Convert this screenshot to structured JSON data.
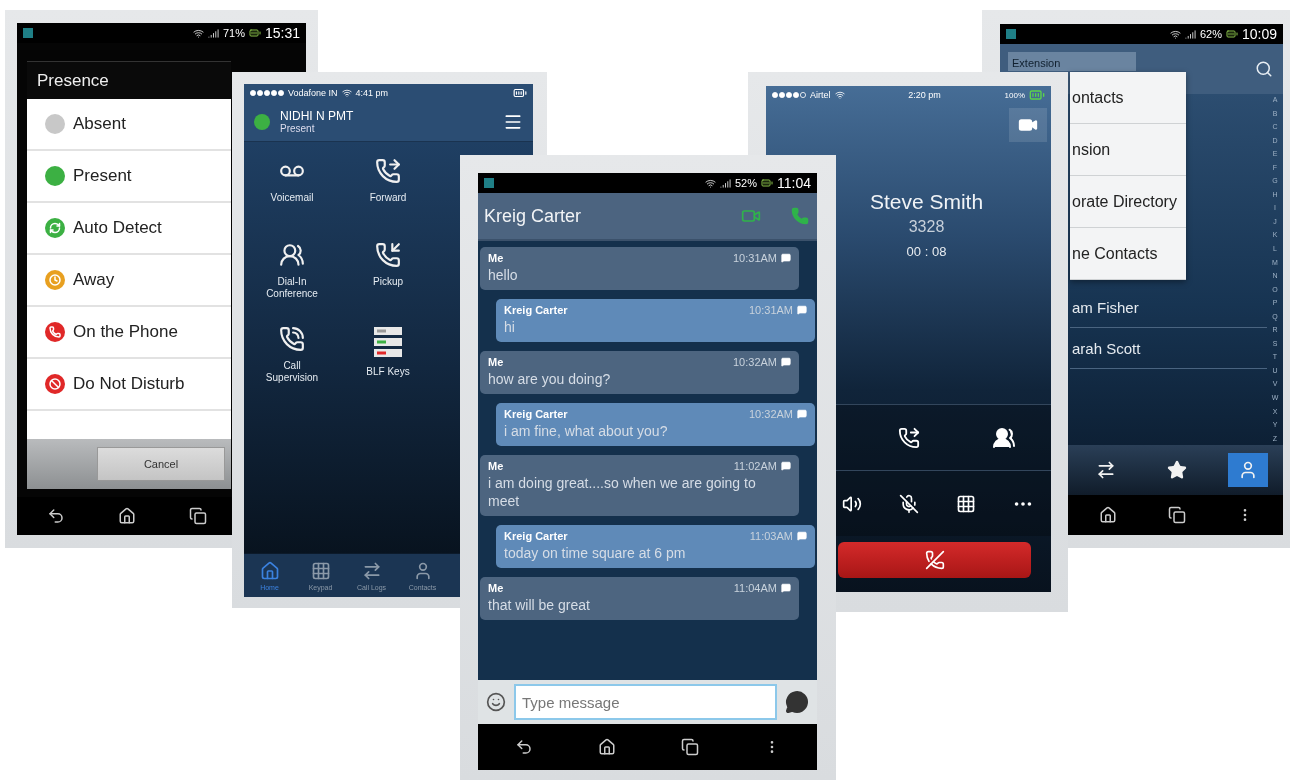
{
  "presence_phone": {
    "status_bar": {
      "battery": "71%",
      "time": "15:31"
    },
    "dialog": {
      "title": "Presence",
      "options": [
        {
          "label": "Absent",
          "kind": "dot",
          "color": "#c8c8c8"
        },
        {
          "label": "Present",
          "kind": "dot",
          "color": "#3cb043"
        },
        {
          "label": "Auto Detect",
          "kind": "auto",
          "color": "#3cb043"
        },
        {
          "label": "Away",
          "kind": "clock",
          "color": "#e8a020"
        },
        {
          "label": "On the Phone",
          "kind": "phone",
          "color": "#e02828"
        },
        {
          "label": "Do Not Disturb",
          "kind": "block",
          "color": "#e02828"
        }
      ],
      "cancel": "Cancel"
    }
  },
  "home_phone": {
    "status_bar": {
      "carrier": "Vodafone IN",
      "time": "4:41 pm"
    },
    "user": {
      "name": "NIDHI N PMT",
      "presence": "Present",
      "color": "#3cb043"
    },
    "features": [
      {
        "label": "Voicemail",
        "kind": "voicemail"
      },
      {
        "label": "Forward",
        "kind": "forward"
      },
      {
        "label": "Dial-In Conference",
        "kind": "conference"
      },
      {
        "label": "Pickup",
        "kind": "pickup"
      },
      {
        "label": "Call Supervision",
        "kind": "supervision"
      },
      {
        "label": "BLF Keys",
        "kind": "blf"
      }
    ],
    "tabs": [
      {
        "label": "Home",
        "kind": "home",
        "selected": true
      },
      {
        "label": "Keypad",
        "kind": "keypad",
        "selected": false
      },
      {
        "label": "Call Logs",
        "kind": "logs",
        "selected": false
      },
      {
        "label": "Contacts",
        "kind": "contacts",
        "selected": false
      }
    ]
  },
  "chat_phone": {
    "status_bar": {
      "battery": "52%",
      "time": "11:04"
    },
    "contact": "Kreig Carter",
    "messages": [
      {
        "kind": "me",
        "sender": "Me",
        "time": "10:31AM",
        "text": "hello"
      },
      {
        "kind": "them",
        "sender": "Kreig Carter",
        "time": "10:31AM",
        "text": "hi"
      },
      {
        "kind": "me",
        "sender": "Me",
        "time": "10:32AM",
        "text": "how are you doing?"
      },
      {
        "kind": "them",
        "sender": "Kreig Carter",
        "time": "10:32AM",
        "text": "i am fine, what about you?"
      },
      {
        "kind": "me",
        "sender": "Me",
        "time": "11:02AM",
        "text": "i am doing great....so when we are going to meet"
      },
      {
        "kind": "them",
        "sender": "Kreig Carter",
        "time": "11:03AM",
        "text": "today on time square at 6 pm"
      },
      {
        "kind": "me",
        "sender": "Me",
        "time": "11:04AM",
        "text": "that will be great"
      }
    ],
    "input": {
      "placeholder": "Type message"
    }
  },
  "call_phone": {
    "status_bar": {
      "carrier": "Airtel",
      "time": "2:20 pm",
      "battery": "100%"
    },
    "caller": {
      "name": "Steve Smith",
      "number": "3328",
      "duration": "00 : 08"
    }
  },
  "contacts_phone": {
    "status_bar": {
      "battery": "62%",
      "time": "10:09"
    },
    "filter": "Extension",
    "menu": [
      "ontacts",
      "nsion",
      "orate Directory",
      "ne Contacts"
    ],
    "contacts": [
      "am Fisher",
      "arah Scott"
    ],
    "index_letters": [
      "A",
      "B",
      "C",
      "D",
      "E",
      "F",
      "G",
      "H",
      "I",
      "J",
      "K",
      "L",
      "M",
      "N",
      "O",
      "P",
      "Q",
      "R",
      "S",
      "T",
      "U",
      "V",
      "W",
      "X",
      "Y",
      "Z"
    ],
    "tabs": [
      {
        "kind": "logs",
        "selected": false
      },
      {
        "kind": "favorites",
        "selected": false
      },
      {
        "kind": "contacts",
        "selected": true
      }
    ]
  }
}
